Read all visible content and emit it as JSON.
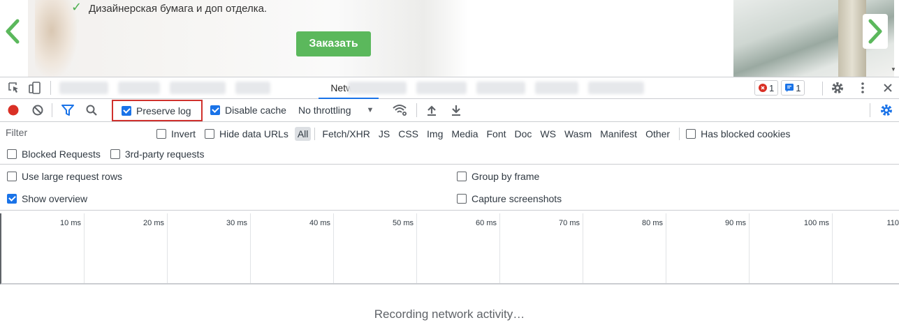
{
  "page": {
    "feature_text": "Дизайнерская бумага и доп отделка.",
    "order_button": "Заказать"
  },
  "devtools": {
    "active_tab": "Network",
    "errors_count": "1",
    "messages_count": "1",
    "toolbar": {
      "preserve_log": "Preserve log",
      "preserve_log_checked": true,
      "disable_cache": "Disable cache",
      "disable_cache_checked": true,
      "throttling": "No throttling"
    },
    "filter": {
      "placeholder": "Filter",
      "invert": "Invert",
      "hide_data_urls": "Hide data URLs",
      "types": [
        "All",
        "Fetch/XHR",
        "JS",
        "CSS",
        "Img",
        "Media",
        "Font",
        "Doc",
        "WS",
        "Wasm",
        "Manifest",
        "Other"
      ],
      "active_type": "All",
      "has_blocked_cookies": "Has blocked cookies",
      "blocked_requests": "Blocked Requests",
      "third_party": "3rd-party requests"
    },
    "settings": {
      "large_rows": "Use large request rows",
      "large_rows_checked": false,
      "show_overview": "Show overview",
      "show_overview_checked": true,
      "group_by_frame": "Group by frame",
      "group_by_frame_checked": false,
      "capture_screenshots": "Capture screenshots",
      "capture_screenshots_checked": false
    },
    "timeline_ticks": [
      "10 ms",
      "20 ms",
      "30 ms",
      "40 ms",
      "50 ms",
      "60 ms",
      "70 ms",
      "80 ms",
      "90 ms",
      "100 ms",
      "110"
    ],
    "status": "Recording network activity…"
  },
  "colors": {
    "accent": "#1a73e8",
    "record": "#d93025",
    "highlight_box": "#d0312d",
    "order_button": "#5bb85c",
    "nav_arrow": "#5bb85c"
  }
}
